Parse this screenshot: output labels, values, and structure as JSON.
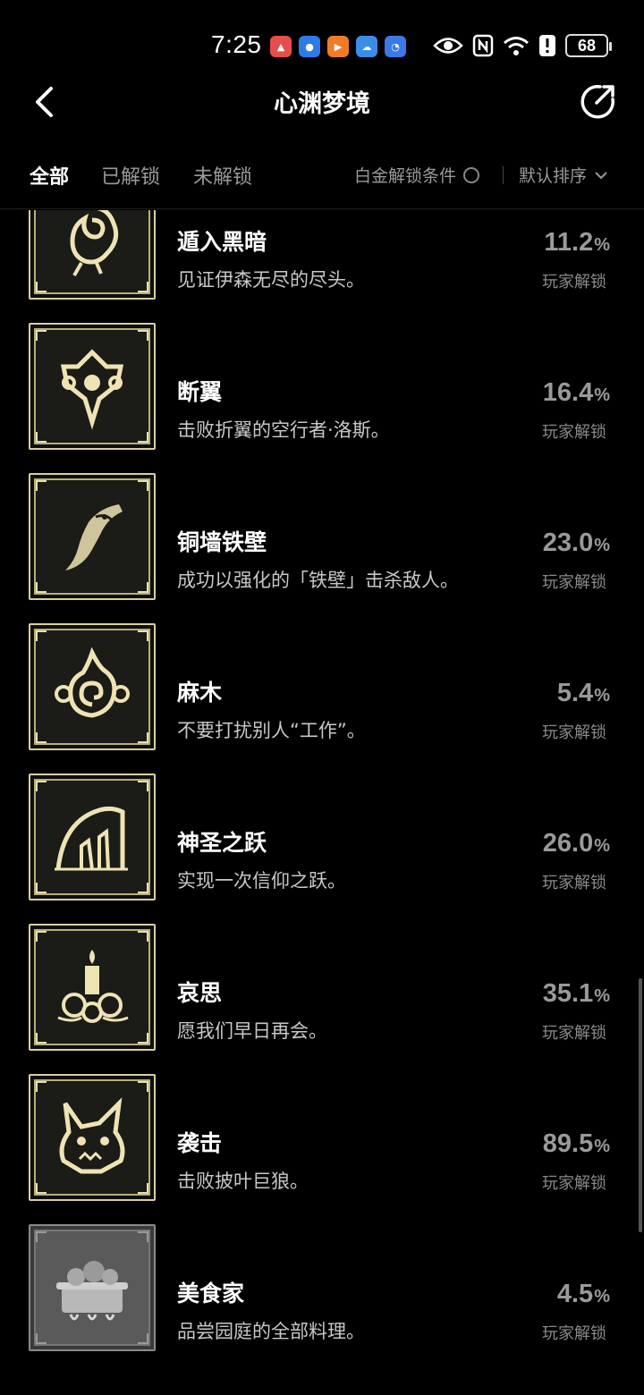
{
  "status_bar": {
    "time": "7:25",
    "battery": "68",
    "app_icons": [
      {
        "name": "huawei-store-icon",
        "color": "#e84d4d",
        "glyph": "▲"
      },
      {
        "name": "app-blue-icon",
        "color": "#2d7be8",
        "glyph": "●"
      },
      {
        "name": "video-app-icon",
        "color": "#f07c2a",
        "glyph": "▶"
      },
      {
        "name": "weather-icon",
        "color": "#3a8ee8",
        "glyph": "☁"
      },
      {
        "name": "chat-app-icon",
        "color": "#3a7ae8",
        "glyph": "◔"
      }
    ]
  },
  "header": {
    "title": "心渊梦境"
  },
  "tabs": [
    {
      "label": "全部",
      "active": true
    },
    {
      "label": "已解锁",
      "active": false
    },
    {
      "label": "未解锁",
      "active": false
    }
  ],
  "filter_label": "白金解锁条件",
  "sort_label": "默认排序",
  "achievements": [
    {
      "name": "遁入黑暗",
      "desc": "见证伊森无尽的尽头。",
      "pct": "11.2",
      "unit": "%",
      "label": "玩家解锁",
      "icon": "dark-rose-icon",
      "locked": false
    },
    {
      "name": "断翼",
      "desc": "击败折翼的空行者·洛斯。",
      "pct": "16.4",
      "unit": "%",
      "label": "玩家解锁",
      "icon": "broken-wing-icon",
      "locked": false
    },
    {
      "name": "铜墙铁壁",
      "desc": "成功以强化的「铁壁」击杀敌人。",
      "pct": "23.0",
      "unit": "%",
      "label": "玩家解锁",
      "icon": "dragon-blade-icon",
      "locked": false
    },
    {
      "name": "麻木",
      "desc": "不要打扰别人“工作”。",
      "pct": "5.4",
      "unit": "%",
      "label": "玩家解锁",
      "icon": "spiral-flame-icon",
      "locked": false
    },
    {
      "name": "神圣之跃",
      "desc": "实现一次信仰之跃。",
      "pct": "26.0",
      "unit": "%",
      "label": "玩家解锁",
      "icon": "holy-arch-icon",
      "locked": false
    },
    {
      "name": "哀思",
      "desc": "愿我们早日再会。",
      "pct": "35.1",
      "unit": "%",
      "label": "玩家解锁",
      "icon": "candle-roses-icon",
      "locked": false
    },
    {
      "name": "袭击",
      "desc": "击败披叶巨狼。",
      "pct": "89.5",
      "unit": "%",
      "label": "玩家解锁",
      "icon": "wolf-head-icon",
      "locked": false
    },
    {
      "name": "美食家",
      "desc": "品尝园庭的全部料理。",
      "pct": "4.5",
      "unit": "%",
      "label": "玩家解锁",
      "icon": "cooking-pot-icon",
      "locked": true
    }
  ]
}
